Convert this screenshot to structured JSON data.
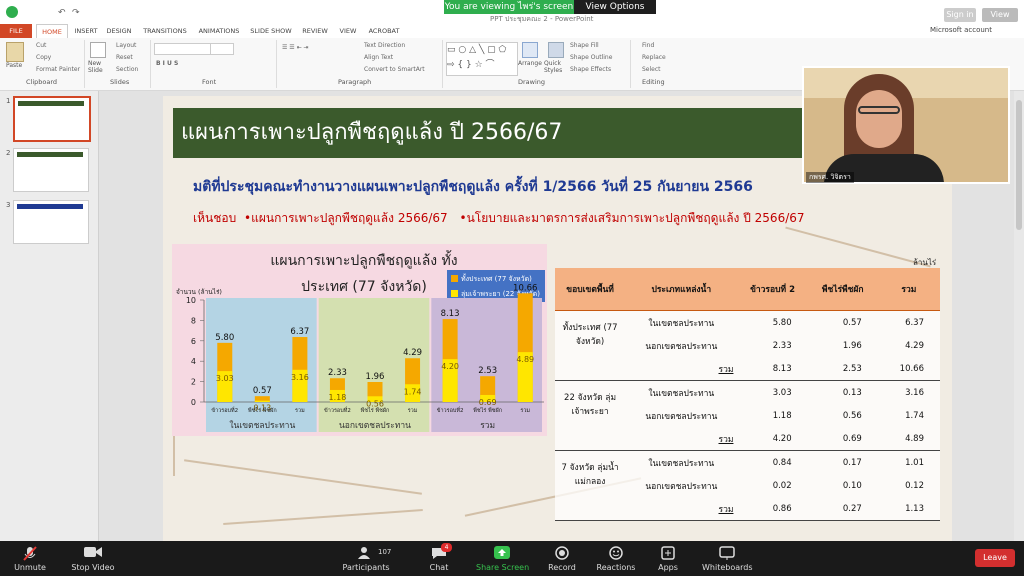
{
  "banner": {
    "viewing": "You are viewing ไพร่'s screen",
    "view_options": "View Options"
  },
  "window": {
    "doc_title": "PPT ประชุมคณะ 2 - PowerPoint",
    "sign_in": "Sign in",
    "view": "View"
  },
  "ribbon": {
    "tabs": [
      "FILE",
      "HOME",
      "INSERT",
      "DESIGN",
      "TRANSITIONS",
      "ANIMATIONS",
      "SLIDE SHOW",
      "REVIEW",
      "VIEW",
      "ACROBAT"
    ],
    "account": "Microsoft account",
    "groups": [
      "Clipboard",
      "Slides",
      "Font",
      "Paragraph",
      "Drawing",
      "Editing"
    ],
    "clipboard": {
      "paste": "Paste",
      "cut": "Cut",
      "copy": "Copy",
      "format_painter": "Format Painter"
    },
    "slides": {
      "new_slide": "New Slide",
      "layout": "Layout",
      "reset": "Reset",
      "section": "Section"
    },
    "paragraph": {
      "text_direction": "Text Direction",
      "align_text": "Align Text",
      "convert_smartart": "Convert to SmartArt"
    },
    "drawing": {
      "arrange": "Arrange",
      "quick_styles": "Quick Styles",
      "shape_fill": "Shape Fill",
      "shape_outline": "Shape Outline",
      "shape_effects": "Shape Effects"
    },
    "editing": {
      "find": "Find",
      "replace": "Replace",
      "select": "Select"
    }
  },
  "thumbnails": [
    "1",
    "2",
    "3"
  ],
  "slide": {
    "title": "แผนการเพาะปลูกพืชฤดูแล้ง ปี 2566/67",
    "subtitle": "มติที่ประชุมคณะทำงานวางแผนเพาะปลูกพืชฤดูแล้ง ครั้งที่ 1/2566 วันที่ 25 กันยายน 2566",
    "ack_prefix": "เห็นชอบ",
    "ack_item1": "•แผนการเพาะปลูกพืชฤดูแล้ง 2566/67",
    "ack_item2": "•นโยบายและมาตรการส่งเสริมการเพาะปลูกพืชฤดูแล้ง ปี 2566/67"
  },
  "chart_data": {
    "type": "bar",
    "title_line1": "แผนการเพาะปลูกพืชฤดูแล้ง ทั้ง",
    "title_line2": "ประเทศ (77 จังหวัด)",
    "ylabel": "จำนวน (ล้านไร่)",
    "ylim": [
      0,
      10
    ],
    "yticks": [
      0,
      2,
      4,
      6,
      8,
      10
    ],
    "groups": [
      {
        "label": "ในเขตชลประทาน",
        "color": "#b4d4e4"
      },
      {
        "label": "นอกเขตชลประทาน",
        "color": "#d4e0b0"
      },
      {
        "label": "รวม",
        "color": "#c9b8d8"
      }
    ],
    "categories": [
      "ข้าวรอบที่2",
      "พืชไร่ พืชผัก",
      "รวม",
      "ข้าวรอบที่2",
      "พืชไร่ พืชผัก",
      "รวม",
      "ข้าวรอบที่2",
      "พืชไร่ พืชผัก",
      "รวม"
    ],
    "series": [
      {
        "name": "ทั้งประเทศ (77 จังหวัด)",
        "color": "#f5a800",
        "values": [
          5.8,
          0.57,
          6.37,
          2.33,
          1.96,
          4.29,
          8.13,
          2.53,
          10.66
        ]
      },
      {
        "name": "ลุ่มเจ้าพระยา (22 จังหวัด)",
        "color": "#ffe600",
        "values": [
          3.03,
          0.13,
          3.16,
          1.18,
          0.56,
          1.74,
          4.2,
          0.69,
          4.89
        ]
      }
    ]
  },
  "table": {
    "unit": "ล้านไร่",
    "headers": [
      "ขอบเขตพื้นที่",
      "ประเภทแหล่งน้ำ",
      "ข้าวรอบที่ 2",
      "พืชไร่พืชผัก",
      "รวม"
    ],
    "sections": [
      {
        "area": "ทั้งประเทศ (77 จังหวัด)",
        "rows": [
          [
            "ในเขตชลประทาน",
            "5.80",
            "0.57",
            "6.37"
          ],
          [
            "นอกเขตชลประทาน",
            "2.33",
            "1.96",
            "4.29"
          ],
          [
            "รวม",
            "8.13",
            "2.53",
            "10.66"
          ]
        ]
      },
      {
        "area": "22 จังหวัด ลุ่มเจ้าพระยา",
        "rows": [
          [
            "ในเขตชลประทาน",
            "3.03",
            "0.13",
            "3.16"
          ],
          [
            "นอกเขตชลประทาน",
            "1.18",
            "0.56",
            "1.74"
          ],
          [
            "รวม",
            "4.20",
            "0.69",
            "4.89"
          ]
        ]
      },
      {
        "area": "7 จังหวัด ลุ่มน้ำแม่กลอง",
        "rows": [
          [
            "ในเขตชลประทาน",
            "0.84",
            "0.17",
            "1.01"
          ],
          [
            "นอกเขตชลประทาน",
            "0.02",
            "0.10",
            "0.12"
          ],
          [
            "รวม",
            "0.86",
            "0.27",
            "1.13"
          ]
        ]
      }
    ]
  },
  "webcam": {
    "name": "กพรศ. วิจิตรา"
  },
  "zoom": {
    "unmute": "Unmute",
    "stop_video": "Stop Video",
    "participants": "Participants",
    "participants_count": "107",
    "chat": "Chat",
    "chat_badge": "4",
    "share_screen": "Share Screen",
    "record": "Record",
    "reactions": "Reactions",
    "apps": "Apps",
    "whiteboards": "Whiteboards",
    "leave": "Leave"
  },
  "colors": {
    "title_bar": "#3b5a2c",
    "file_tab": "#d24726",
    "share_green": "#2fae4e",
    "leave_red": "#d32f2f",
    "table_header": "#f4b183"
  }
}
